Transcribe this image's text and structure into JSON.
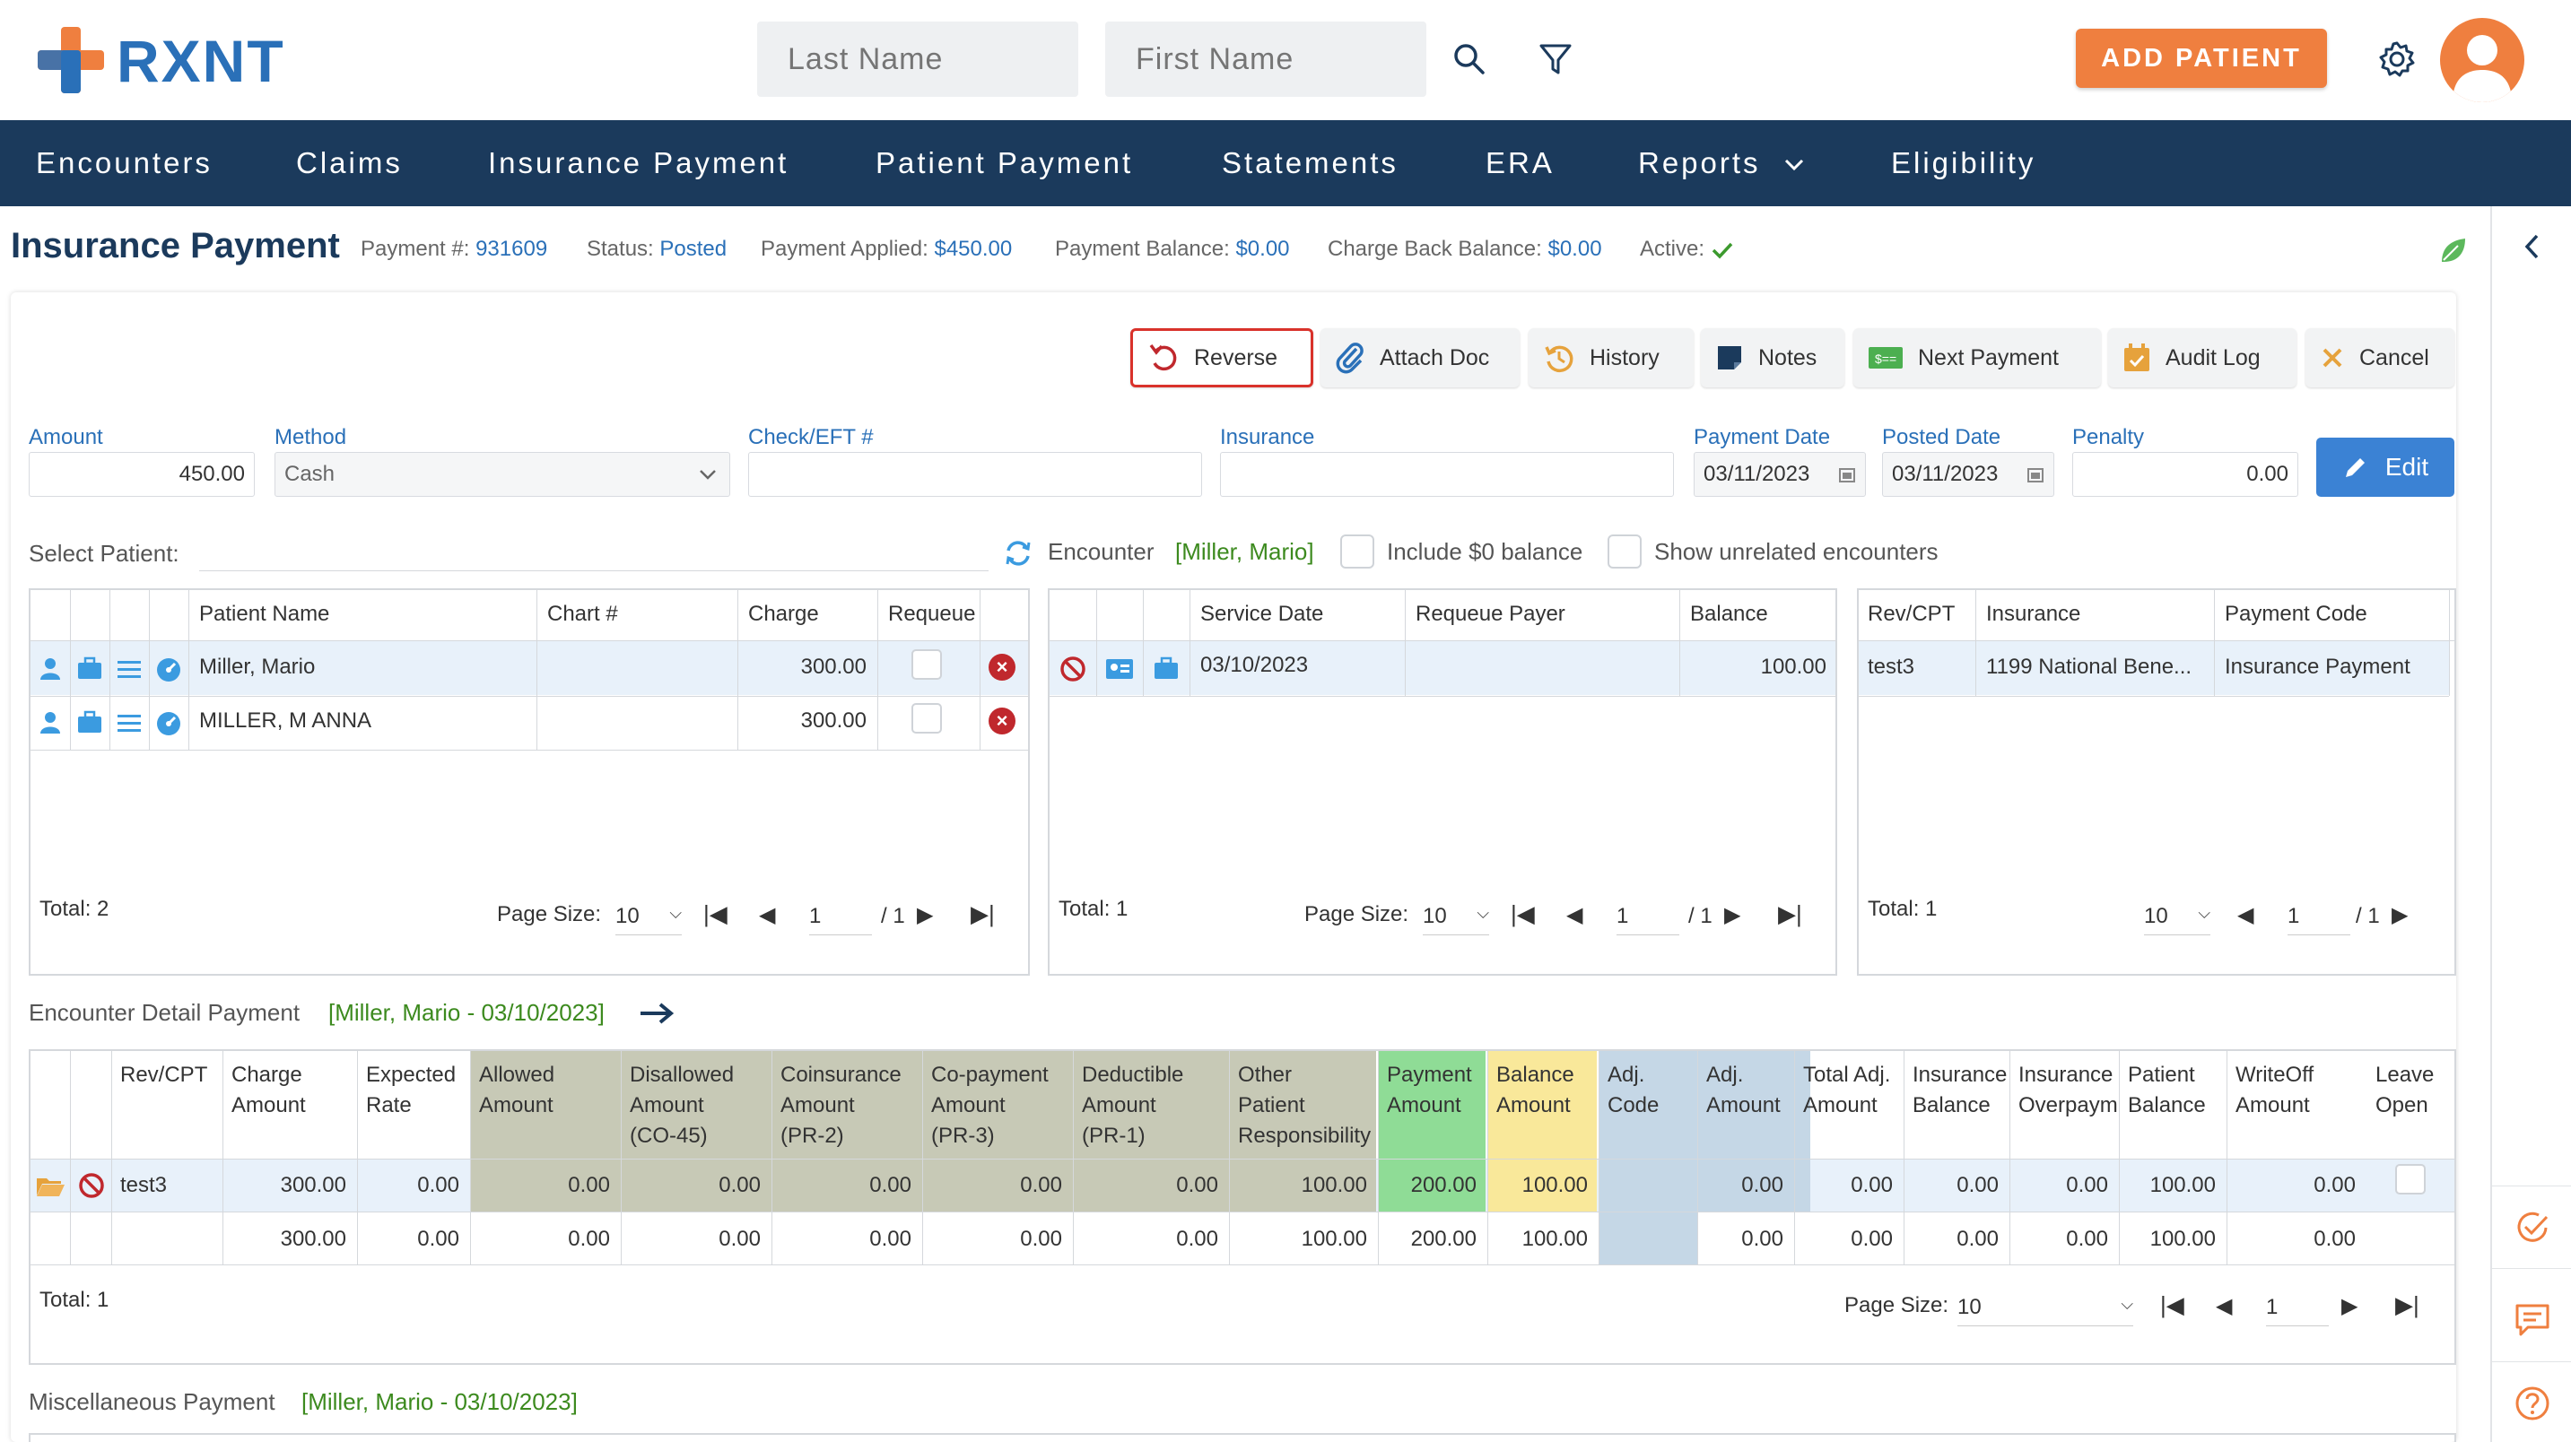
{
  "header": {
    "logo_text": "RXNT",
    "last_name_placeholder": "Last Name",
    "first_name_placeholder": "First Name",
    "add_patient_label": "ADD PATIENT"
  },
  "nav": {
    "items": [
      {
        "label": "Encounters"
      },
      {
        "label": "Claims"
      },
      {
        "label": "Insurance Payment"
      },
      {
        "label": "Patient Payment"
      },
      {
        "label": "Statements"
      },
      {
        "label": "ERA"
      },
      {
        "label": "Reports"
      },
      {
        "label": "Eligibility"
      }
    ]
  },
  "payment": {
    "title": "Insurance Payment",
    "payment_no_label": "Payment #:",
    "payment_no": "931609",
    "status_label": "Status:",
    "status": "Posted",
    "applied_label": "Payment Applied:",
    "applied": "$450.00",
    "balance_label": "Payment Balance:",
    "balance": "$0.00",
    "chargeback_label": "Charge Back Balance:",
    "chargeback": "$0.00",
    "active_label": "Active:"
  },
  "toolbar": {
    "reverse": "Reverse",
    "attach_doc": "Attach Doc",
    "history": "History",
    "notes": "Notes",
    "next_payment": "Next Payment",
    "audit_log": "Audit Log",
    "cancel": "Cancel"
  },
  "form": {
    "amount_label": "Amount",
    "amount": "450.00",
    "method_label": "Method",
    "method": "Cash",
    "check_label": "Check/EFT #",
    "check": "",
    "insurance_label": "Insurance",
    "insurance": "",
    "payment_date_label": "Payment Date",
    "payment_date": "03/11/2023",
    "posted_date_label": "Posted Date",
    "posted_date": "03/11/2023",
    "penalty_label": "Penalty",
    "penalty": "0.00",
    "edit_label": "Edit",
    "select_patient_label": "Select Patient:",
    "encounter_label": "Encounter",
    "encounter_patient": "[Miller, Mario]",
    "include_zero_label": "Include $0 balance",
    "show_unrelated_label": "Show unrelated encounters"
  },
  "patients_grid": {
    "headers": [
      "Patient Name",
      "Chart #",
      "Charge",
      "Requeue"
    ],
    "rows": [
      {
        "name": "Miller, Mario",
        "chart": "",
        "charge": "300.00"
      },
      {
        "name": "MILLER, M ANNA",
        "chart": "",
        "charge": "300.00"
      }
    ],
    "total": "Total: 2",
    "page_size_label": "Page Size:",
    "page_size": "10",
    "page": "1",
    "page_of": "/ 1"
  },
  "encounters_grid": {
    "headers": [
      "Service Date",
      "Requeue Payer",
      "Balance"
    ],
    "rows": [
      {
        "service_date": "03/10/2023",
        "payer": "",
        "balance": "100.00"
      }
    ],
    "total": "Total: 1",
    "page_size_label": "Page Size:",
    "page_size": "10",
    "page": "1",
    "page_of": "/ 1"
  },
  "charges_grid": {
    "headers": [
      "Rev/CPT",
      "Insurance",
      "Payment Code"
    ],
    "rows": [
      {
        "cpt": "test3",
        "insurance": "1199 National Bene...",
        "code": "Insurance Payment"
      }
    ],
    "total": "Total: 1",
    "page_size": "10",
    "page": "1",
    "page_of": "/ 1"
  },
  "detail": {
    "label": "Encounter Detail Payment",
    "context": "[Miller, Mario - 03/10/2023]",
    "headers": [
      [
        "Rev/CPT"
      ],
      [
        "Charge",
        "Amount"
      ],
      [
        "Expected",
        "Rate"
      ],
      [
        "Allowed",
        "Amount"
      ],
      [
        "Disallowed",
        "Amount",
        "(CO-45)"
      ],
      [
        "Coinsurance",
        "Amount",
        "(PR-2)"
      ],
      [
        "Co-payment",
        "Amount",
        "(PR-3)"
      ],
      [
        "Deductible",
        "Amount",
        "(PR-1)"
      ],
      [
        "Other",
        "Patient",
        "Responsibility"
      ],
      [
        "Payment",
        "Amount"
      ],
      [
        "Balance",
        "Amount"
      ],
      [
        "Adj.",
        "Code"
      ],
      [
        "Adj.",
        "Amount"
      ],
      [
        "Total Adj.",
        "Amount"
      ],
      [
        "Insurance",
        "Balance"
      ],
      [
        "Insurance",
        "Overpaymen"
      ],
      [
        "Patient",
        "Balance"
      ],
      [
        "WriteOff",
        "Amount"
      ],
      [
        "Leave",
        "Open"
      ]
    ],
    "row1": [
      "test3",
      "300.00",
      "0.00",
      "0.00",
      "0.00",
      "0.00",
      "0.00",
      "0.00",
      "100.00",
      "200.00",
      "100.00",
      "",
      "0.00",
      "0.00",
      "0.00",
      "0.00",
      "100.00",
      "0.00"
    ],
    "row2": [
      "",
      "300.00",
      "0.00",
      "0.00",
      "0.00",
      "0.00",
      "0.00",
      "0.00",
      "100.00",
      "200.00",
      "100.00",
      "",
      "0.00",
      "0.00",
      "0.00",
      "0.00",
      "100.00",
      "0.00"
    ],
    "total": "Total: 1",
    "page_size_label": "Page Size:",
    "page_size": "10",
    "page": "1"
  },
  "misc": {
    "label": "Miscellaneous Payment",
    "context": "[Miller, Mario - 03/10/2023]"
  },
  "colors": {
    "nav_bg": "#1b3a5c",
    "accent_orange": "#ef7f3f",
    "link_blue": "#2a70b8",
    "band_olive": "#c7c9b6",
    "band_green": "#8fdc96",
    "band_yellow": "#f9e89a",
    "band_blue": "#c5d7e6"
  }
}
